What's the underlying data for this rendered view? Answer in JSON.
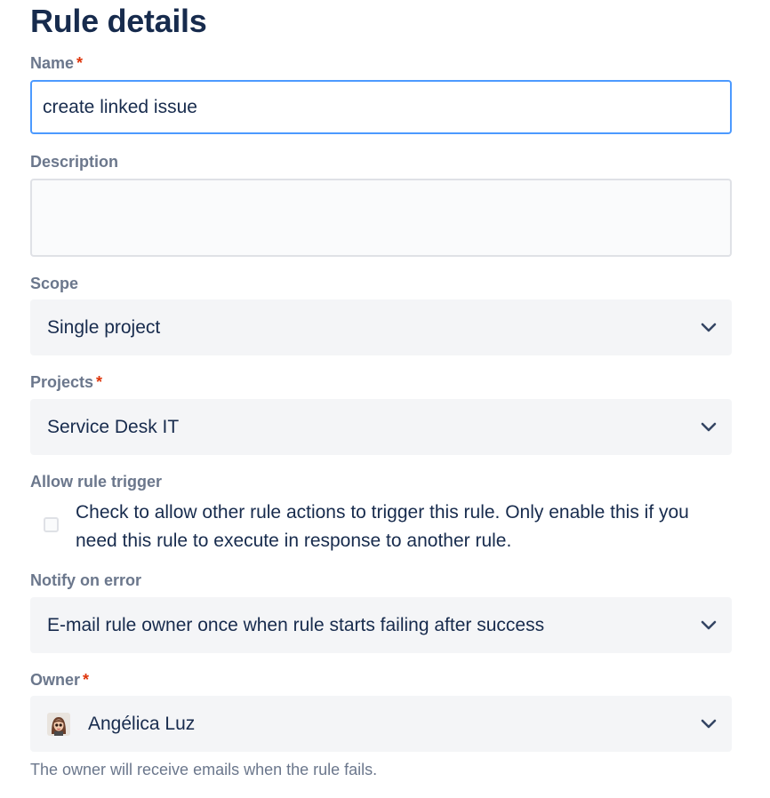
{
  "page_title": "Rule details",
  "required_marker": "*",
  "name": {
    "label": "Name",
    "value": "create linked issue"
  },
  "description": {
    "label": "Description",
    "value": ""
  },
  "scope": {
    "label": "Scope",
    "value": "Single project"
  },
  "projects": {
    "label": "Projects",
    "value": "Service Desk IT"
  },
  "allow_rule_trigger": {
    "label": "Allow rule trigger",
    "checked": false,
    "text": "Check to allow other rule actions to trigger this rule. Only enable this if you need this rule to execute in response to another rule."
  },
  "notify_on_error": {
    "label": "Notify on error",
    "value": "E-mail rule owner once when rule starts failing after success"
  },
  "owner": {
    "label": "Owner",
    "value": "Angélica Luz",
    "helper": "The owner will receive emails when the rule fails.",
    "avatar_icon": "user-avatar-icon"
  },
  "icons": {
    "dropdown": "chevron-down-icon"
  },
  "colors": {
    "heading": "#172b4d",
    "label": "#6b778c",
    "required": "#de350b",
    "focus_border": "#4c9aff",
    "field_bg": "#f4f5f7"
  }
}
